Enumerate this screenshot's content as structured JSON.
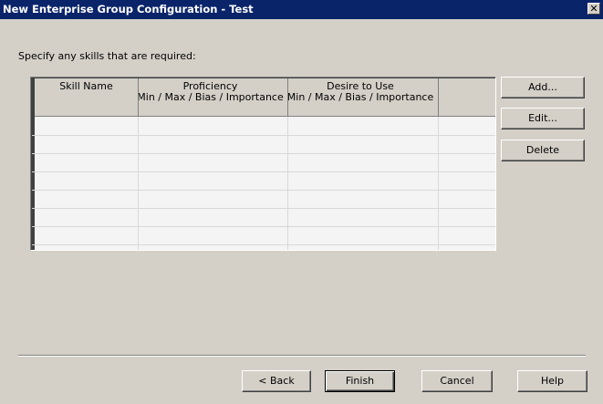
{
  "window": {
    "title": "New Enterprise Group Configuration - Test",
    "close_label": "✕"
  },
  "instructions": "Specify any skills that are required:",
  "table": {
    "columns": [
      {
        "label": "Skill Name",
        "sub": ""
      },
      {
        "label": "Proficiency",
        "sub": "Min / Max / Bias / Importance"
      },
      {
        "label": "Desire to Use",
        "sub": "Min / Max / Bias / Importance"
      },
      {
        "label": "",
        "sub": ""
      }
    ],
    "rows": []
  },
  "side_buttons": {
    "add": "Add...",
    "edit": "Edit...",
    "delete": "Delete"
  },
  "footer_buttons": {
    "back": "< Back",
    "finish": "Finish",
    "cancel": "Cancel",
    "help": "Help"
  }
}
